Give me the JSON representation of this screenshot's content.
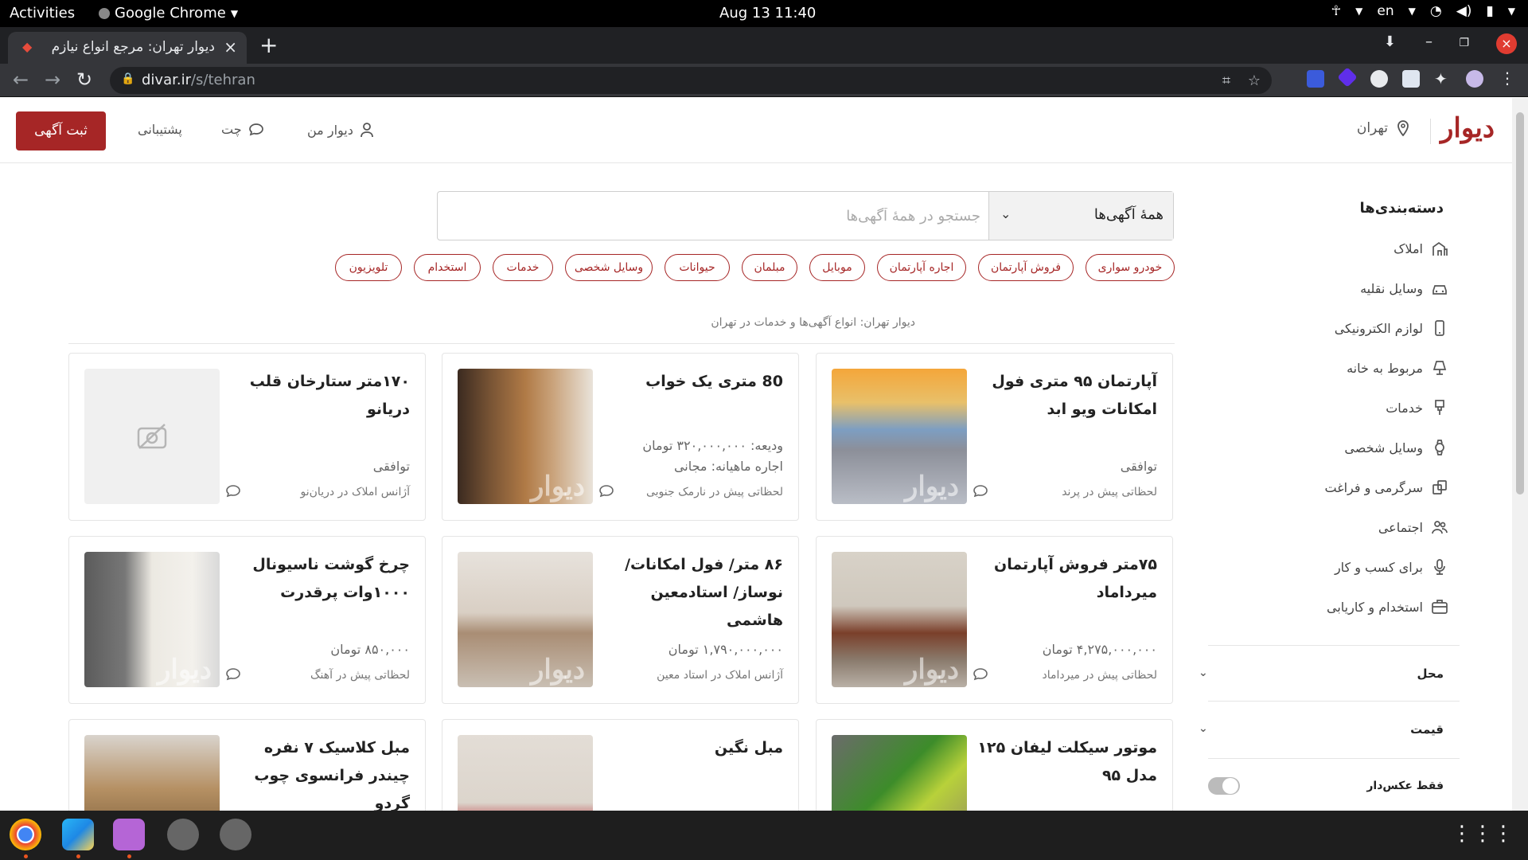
{
  "system": {
    "activities": "Activities",
    "app_name": "Google Chrome",
    "clock": "Aug 13  11:40",
    "lang": "en"
  },
  "browser": {
    "tab_title": "دیوار تهران: مرجع انواع نیازم",
    "url_host": "divar.ir",
    "url_path": "/s/tehran"
  },
  "header": {
    "logo": "دیوار",
    "city": "تهران",
    "my_divar": "دیوار من",
    "chat": "چت",
    "support": "پشتیبانی",
    "post_ad": "ثبت آگهی"
  },
  "search": {
    "category": "همهٔ آگهی‌ها",
    "placeholder": "جستجو در همهٔ آگهی‌ها"
  },
  "chips": [
    "خودرو سواری",
    "فروش آپارتمان",
    "اجاره آپارتمان",
    "موبایل",
    "مبلمان",
    "حیوانات",
    "وسایل شخصی",
    "خدمات",
    "استخدام",
    "تلویزیون"
  ],
  "breadcrumb": "دیوار تهران: انواع آگهی‌ها و خدمات در تهران",
  "sidebar": {
    "title": "دسته‌بندی‌ها",
    "items": [
      "املاک",
      "وسایل نقلیه",
      "لوازم الکترونیکی",
      "مربوط به خانه",
      "خدمات",
      "وسایل شخصی",
      "سرگرمی و فراغت",
      "اجتماعی",
      "برای کسب و کار",
      "استخدام و کاریابی"
    ],
    "filter_location": "محل",
    "filter_price": "قیمت",
    "photo_only": "فقط عکس‌دار"
  },
  "cards": [
    {
      "title": "آپارتمان ۹۵ متری فول امکانات ویو ابد",
      "line1": "توافقی",
      "line2": "",
      "meta": "لحظاتی پیش در پرند"
    },
    {
      "title": "80 متری یک خواب",
      "line1": "اجاره ماهیانه: مجانی",
      "line2": "ودیعه: ۳۲۰,۰۰۰,۰۰۰ تومان",
      "meta": "لحظاتی پیش در نارمک جنوبی"
    },
    {
      "title": "۱۷۰متر ستارخان قلب دریانو",
      "line1": "توافقی",
      "line2": "",
      "meta": "آژانس املاک در دریان‌نو"
    },
    {
      "title": "۷۵متر فروش آپارتمان میرداماد",
      "line1": "۴,۲۷۵,۰۰۰,۰۰۰ تومان",
      "line2": "",
      "meta": "لحظاتی پیش در میرداماد"
    },
    {
      "title": "۸۶ متر/ فول امکانات/ نوساز/ استادمعین هاشمی",
      "line1": "۱,۷۹۰,۰۰۰,۰۰۰ تومان",
      "line2": "",
      "meta": "آژانس املاک در استاد معین"
    },
    {
      "title": "چرخ گوشت ناسیونال ۱۰۰۰وات پرقدرت",
      "line1": "۸۵۰,۰۰۰ تومان",
      "line2": "",
      "meta": "لحظاتی پیش در آهنگ"
    },
    {
      "title": "موتور سیکلت لیفان ۱۲۵ مدل ۹۵",
      "line1": "",
      "line2": "",
      "meta": ""
    },
    {
      "title": "مبل نگین",
      "line1": "",
      "line2": "",
      "meta": ""
    },
    {
      "title": "مبل کلاسیک ۷ نفره چیندر فرانسوی چوب گردو",
      "line1": "",
      "line2": "",
      "meta": ""
    }
  ],
  "watermark": "دیوار",
  "colors": {
    "brand": "#a62626"
  }
}
